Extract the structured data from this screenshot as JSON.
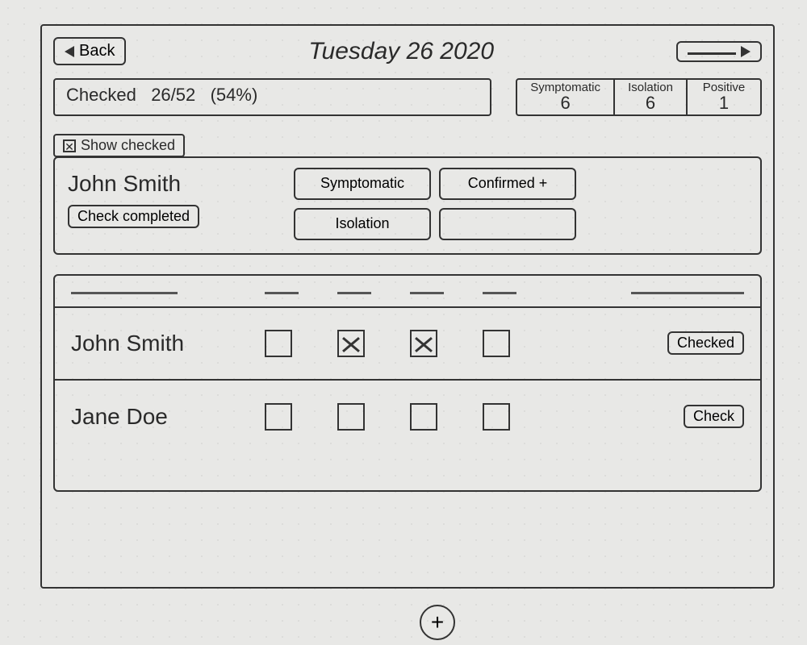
{
  "header": {
    "back_label": "Back",
    "title": "Tuesday 26 2020",
    "forward_label": " "
  },
  "stats": {
    "checked_label": "Checked",
    "checked_value": "26/52",
    "checked_pct": "(54%)",
    "symptomatic_label": "Symptomatic",
    "symptomatic_value": "6",
    "isolation_label": "Isolation",
    "isolation_value": "6",
    "positive_label": "Positive",
    "positive_value": "1"
  },
  "show_checked_label": "Show checked",
  "card": {
    "person_name": "John Smith",
    "check_completed_label": "Check completed",
    "chips": {
      "symptomatic": "Symptomatic",
      "confirmed": "Confirmed +",
      "isolation": "Isolation",
      "blank": ""
    }
  },
  "table": {
    "rows": [
      {
        "name": "John Smith",
        "c1": false,
        "c2": true,
        "c3": true,
        "c4": false,
        "action": "Checked"
      },
      {
        "name": "Jane Doe",
        "c1": false,
        "c2": false,
        "c3": false,
        "c4": false,
        "action": "Check"
      }
    ]
  },
  "fab_label": "+"
}
